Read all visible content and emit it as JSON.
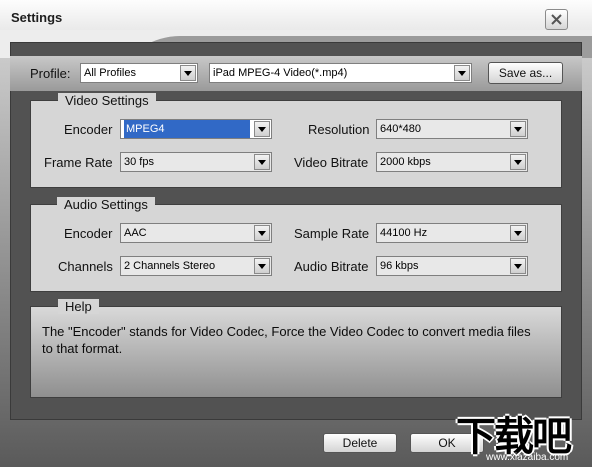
{
  "window": {
    "title": "Settings"
  },
  "profile": {
    "label": "Profile:",
    "category": "All Profiles",
    "format": "iPad MPEG-4 Video(*.mp4)",
    "save_as": "Save as..."
  },
  "video": {
    "legend": "Video Settings",
    "encoder_label": "Encoder",
    "encoder": "MPEG4",
    "resolution_label": "Resolution",
    "resolution": "640*480",
    "frame_rate_label": "Frame Rate",
    "frame_rate": "30 fps",
    "bitrate_label": "Video Bitrate",
    "bitrate": "2000 kbps"
  },
  "audio": {
    "legend": "Audio Settings",
    "encoder_label": "Encoder",
    "encoder": "AAC",
    "sample_rate_label": "Sample Rate",
    "sample_rate": "44100 Hz",
    "channels_label": "Channels",
    "channels": "2 Channels Stereo",
    "bitrate_label": "Audio Bitrate",
    "bitrate": "96 kbps"
  },
  "help": {
    "legend": "Help",
    "text": "The \"Encoder\" stands for Video Codec, Force the Video Codec to convert media files to that format."
  },
  "footer": {
    "delete": "Delete",
    "ok": "OK"
  },
  "watermark": {
    "logo": "下载吧",
    "url": "www.xiazaiba.com"
  }
}
